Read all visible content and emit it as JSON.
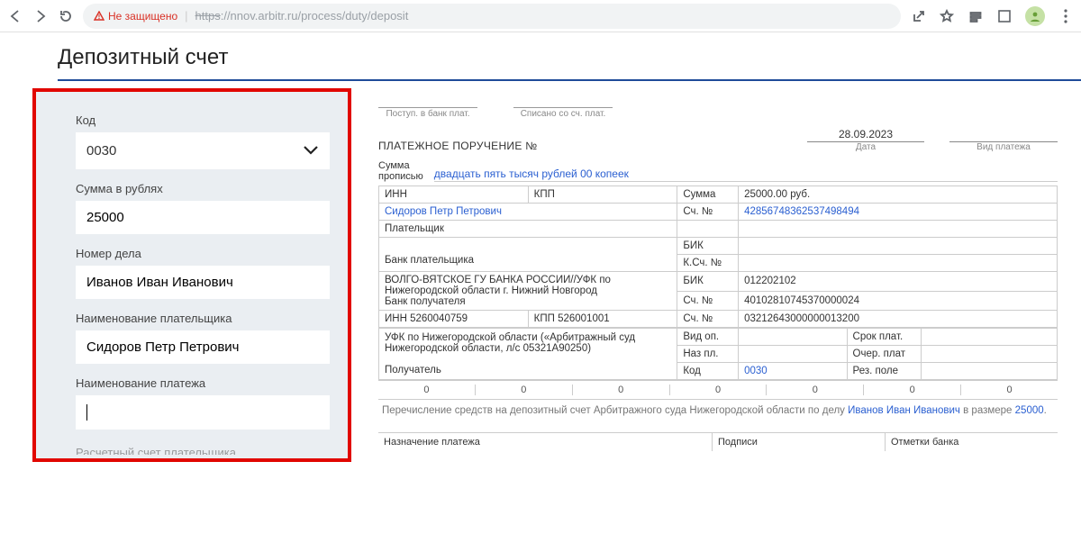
{
  "chrome": {
    "not_secure": "Не защищено",
    "url_struck": "https",
    "url_rest": "://nnov.arbitr.ru/process/duty/deposit"
  },
  "page_title": "Депозитный счет",
  "form": {
    "code_label": "Код",
    "code_value": "0030",
    "sum_label": "Сумма в рублях",
    "sum_value": "25000",
    "case_label": "Номер дела",
    "case_value": "Иванов Иван Иванович",
    "payer_label": "Наименование плательщика",
    "payer_value": "Сидоров Петр Петрович",
    "payment_label": "Наименование платежа",
    "payment_value": "",
    "truncated": "Расчетный счет плательщика"
  },
  "doc": {
    "top": {
      "bank_in": "Поступ. в банк плат.",
      "written_off": "Списано со сч. плат."
    },
    "order_title": "ПЛАТЕЖНОЕ ПОРУЧЕНИЕ №",
    "date": "28.09.2023",
    "date_caption": "Дата",
    "payment_type_caption": "Вид платежа",
    "sum_text_label_1": "Сумма",
    "sum_text_label_2": "прописью",
    "sum_text_value": "двадцать пять тысяч рублей 00 копеек",
    "grid": {
      "inn": "ИНН",
      "kpp": "КПП",
      "sum": "Сумма",
      "sum_val": "25000.00 руб.",
      "payer_link": "Сидоров Петр Петрович",
      "acc": "Сч. №",
      "acc_val": "42856748362537498494",
      "payer": "Плательщик",
      "bik": "БИК",
      "payer_bank": "Банк плательщика",
      "ksch": "К.Сч. №",
      "recipient_bank_line1": "ВОЛГО-ВЯТСКОЕ ГУ БАНКА РОССИИ//УФК по",
      "recipient_bank_line2": "Нижегородской области г. Нижний Новгород",
      "recipient_bank": "Банк получателя",
      "bik_val": "012202102",
      "sch_val1": "40102810745370000024",
      "inn_val": "ИНН 5260040759",
      "kpp_val": "КПП 526001001",
      "sch_val2": "03212643000000013200",
      "ufk_line1": "УФК по Нижегородской области («Арбитражный суд",
      "ufk_line2": "Нижегородской области, л/с 05321А90250)",
      "vid_op": "Вид оп.",
      "srok": "Срок плат.",
      "naz_pl": "Наз пл.",
      "ocher": "Очер. плат",
      "recipient": "Получатель",
      "kod": "Код",
      "kod_val": "0030",
      "rez": "Рез. поле",
      "zero": "0"
    },
    "description_1": "Перечисление средств на депозитный счет Арбитражного суда Нижегородской области по делу ",
    "description_case": "Иванов Иван Иванович",
    "description_2": " в размере ",
    "description_sum": "25000",
    "description_3": ".",
    "footer": {
      "purpose": "Назначение платежа",
      "sign": "Подписи",
      "bank_marks": "Отметки банка"
    }
  }
}
